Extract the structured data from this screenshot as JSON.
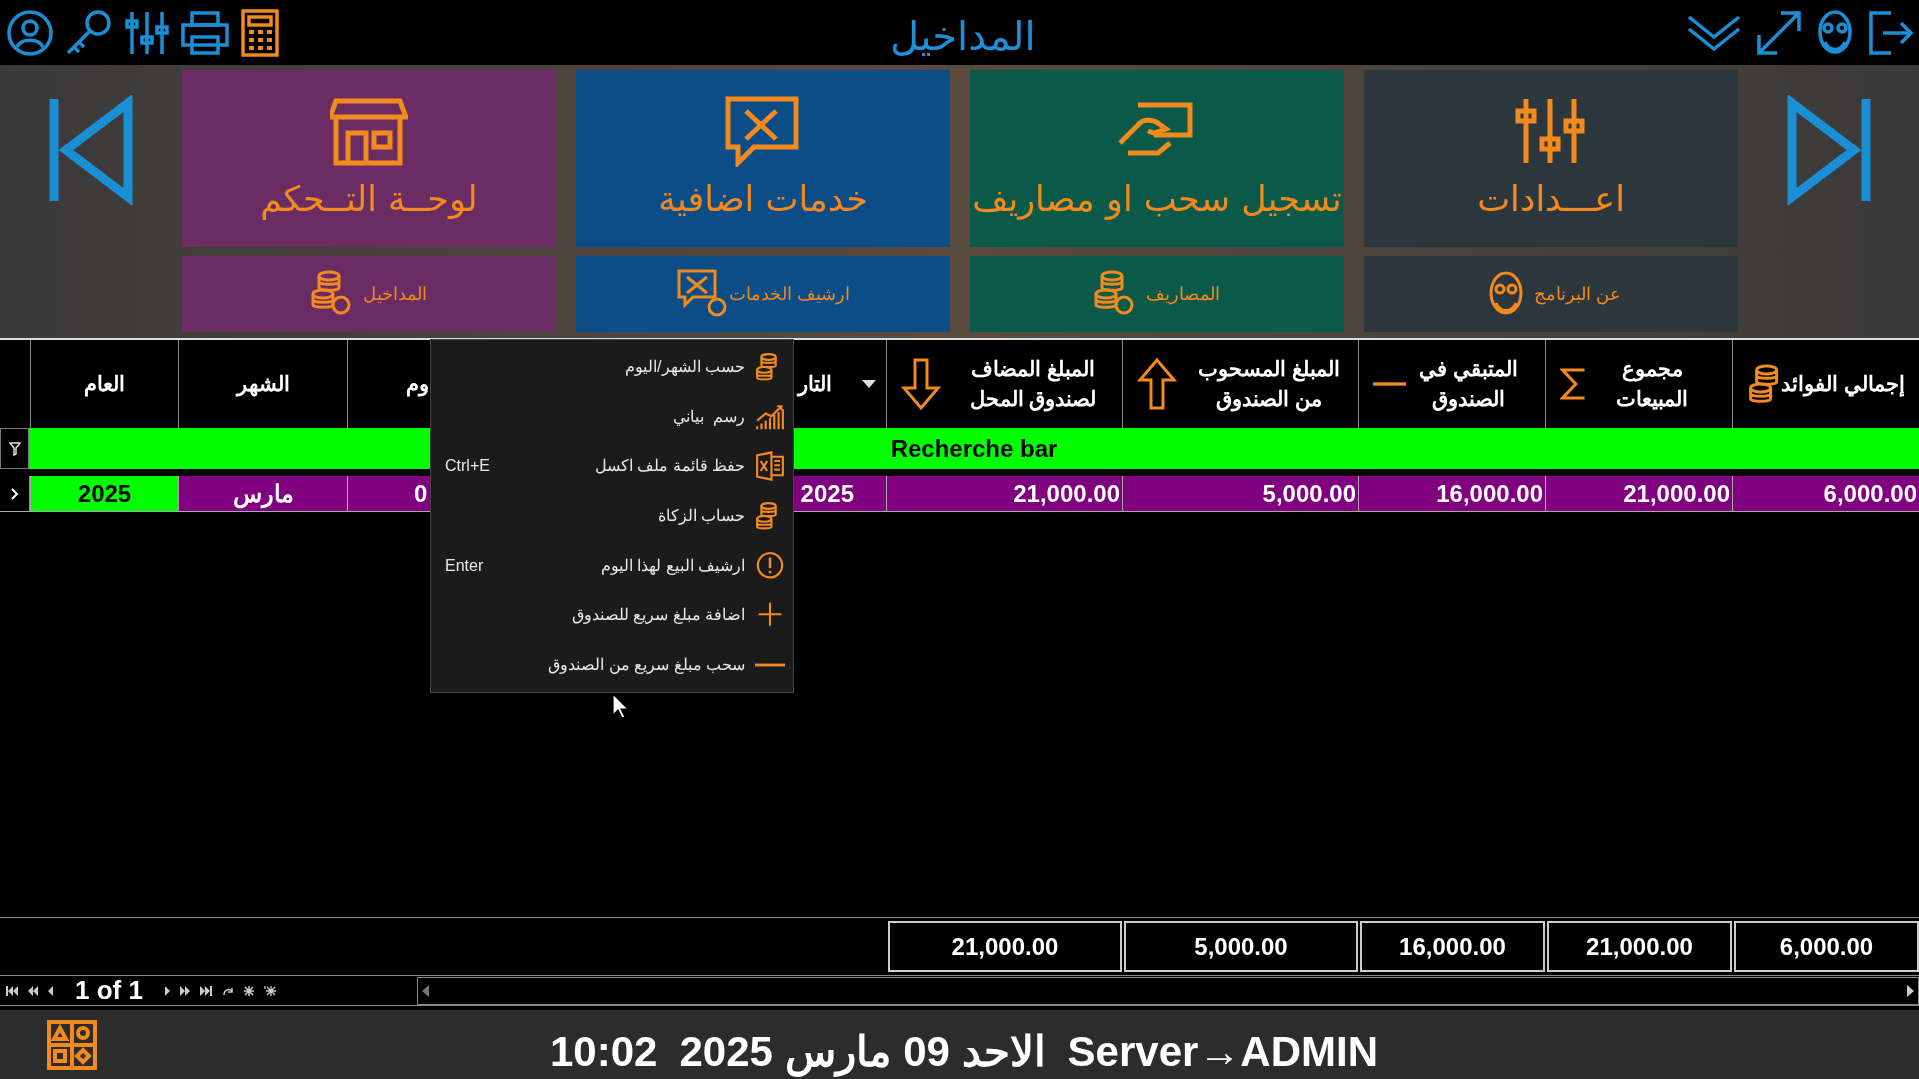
{
  "app_bar": {
    "title": "المداخيل"
  },
  "tiles": [
    {
      "label": "اعـــدادات",
      "color": "#2b373d"
    },
    {
      "label": "تسجيل سحب او مصاريف",
      "color": "#0b5949"
    },
    {
      "label": "خدمات اضافية",
      "color": "#0d4d87"
    },
    {
      "label": "لوحــة التــحكم",
      "color": "#6a2c63"
    }
  ],
  "sub_tiles": [
    {
      "label": "عن البرنامج",
      "color": "#2b373d"
    },
    {
      "label": "المصاريف",
      "color": "#0b5949"
    },
    {
      "label": "ارشيف الخدمات",
      "color": "#0d4d87"
    },
    {
      "label": "المداخيل",
      "color": "#6a2c63"
    }
  ],
  "table": {
    "columns": [
      "إجمالي الفوائد",
      "مجموع المبيعات",
      "المتبقي في الصندوق",
      "المبلغ المسحوب من الصندوق",
      "المبلغ المضاف لصندوق المحل",
      "التار",
      "وم",
      "الشهر",
      "العام"
    ],
    "search_bar": "Recherche bar",
    "rows": [
      {
        "selected": true,
        "cells": [
          "6,000.00",
          "21,000.00",
          "16,000.00",
          "5,000.00",
          "21,000.00",
          "2025",
          "0",
          "مارس",
          "2025"
        ]
      }
    ],
    "totals": [
      "6,000.00",
      "21,000.00",
      "16,000.00",
      "5,000.00",
      "21,000.00"
    ],
    "page_label": "1 of 1"
  },
  "context_menu": [
    {
      "label": "حسب الشهر/اليوم"
    },
    {
      "label": "رسم  بياني"
    },
    {
      "label": "حفظ قائمة ملف اكسل",
      "shortcut": "Ctrl+E"
    },
    {
      "label": "حساب الزكاة"
    },
    {
      "label": "ارشيف البيع لهذا اليوم",
      "shortcut": "Enter"
    },
    {
      "label": "اضافة مبلغ سريع للصندوق"
    },
    {
      "label": "سحب مبلغ سريع من الصندوق"
    }
  ],
  "status_bar": {
    "time": "10:02",
    "date": "الاحد 09 مارس 2025",
    "user": "Server→ADMIN"
  }
}
